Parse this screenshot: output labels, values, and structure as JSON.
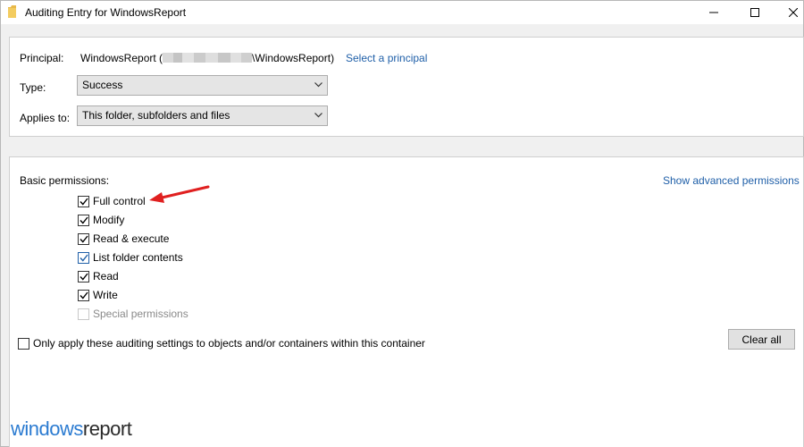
{
  "window": {
    "title": "Auditing Entry for WindowsReport"
  },
  "principal": {
    "label": "Principal:",
    "value_prefix": "WindowsReport (",
    "value_suffix": "\\WindowsReport)",
    "select_link": "Select a principal"
  },
  "type": {
    "label": "Type:",
    "selected": "Success"
  },
  "applies_to": {
    "label": "Applies to:",
    "selected": "This folder, subfolders and files"
  },
  "permissions": {
    "heading": "Basic permissions:",
    "advanced_link": "Show advanced permissions",
    "items": [
      {
        "label": "Full control",
        "checked": true,
        "disabled": false
      },
      {
        "label": "Modify",
        "checked": true,
        "disabled": false
      },
      {
        "label": "Read & execute",
        "checked": true,
        "disabled": false
      },
      {
        "label": "List folder contents",
        "checked": true,
        "disabled": false
      },
      {
        "label": "Read",
        "checked": true,
        "disabled": false
      },
      {
        "label": "Write",
        "checked": true,
        "disabled": false
      },
      {
        "label": "Special permissions",
        "checked": false,
        "disabled": true
      }
    ]
  },
  "only_apply": {
    "label": "Only apply these auditing settings to objects and/or containers within this container",
    "checked": false
  },
  "clear_all_label": "Clear all",
  "watermark": {
    "part1": "windows",
    "part2": "report"
  },
  "colors": {
    "link": "#1f5fa8",
    "annotation_arrow": "#e02020",
    "brand_blue": "#2b7bd1"
  }
}
